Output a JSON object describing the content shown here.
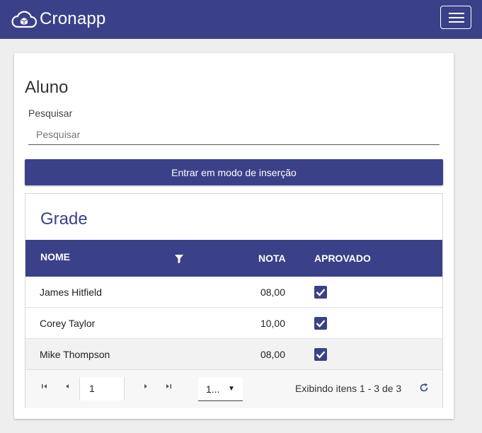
{
  "app": {
    "brand": "Cronapp",
    "brand_icon": "cloud-cube-icon",
    "menu_icon": "hamburger-icon"
  },
  "page": {
    "title": "Aluno",
    "search": {
      "label": "Pesquisar",
      "placeholder": "Pesquisar",
      "value": ""
    },
    "insert_button": "Entrar em modo de inserção"
  },
  "grid": {
    "title": "Grade",
    "columns": [
      "NOME",
      "NOTA",
      "APROVADO"
    ],
    "filter_icon": "filter-icon",
    "rows": [
      {
        "name": "James Hitfield",
        "grade": "08,00",
        "approved": true
      },
      {
        "name": "Corey Taylor",
        "grade": "10,00",
        "approved": true
      },
      {
        "name": "Mike Thompson",
        "grade": "08,00",
        "approved": true
      }
    ],
    "pager": {
      "current_page": "1",
      "page_size": "1...",
      "info": "Exibindo itens 1 - 3 de 3",
      "icons": [
        "first-page-icon",
        "prev-page-icon",
        "next-page-icon",
        "last-page-icon",
        "refresh-icon"
      ]
    }
  },
  "colors": {
    "primary": "#3a4189",
    "background": "#eeeeee",
    "card": "#ffffff",
    "alt_row": "#f2f2f2"
  }
}
